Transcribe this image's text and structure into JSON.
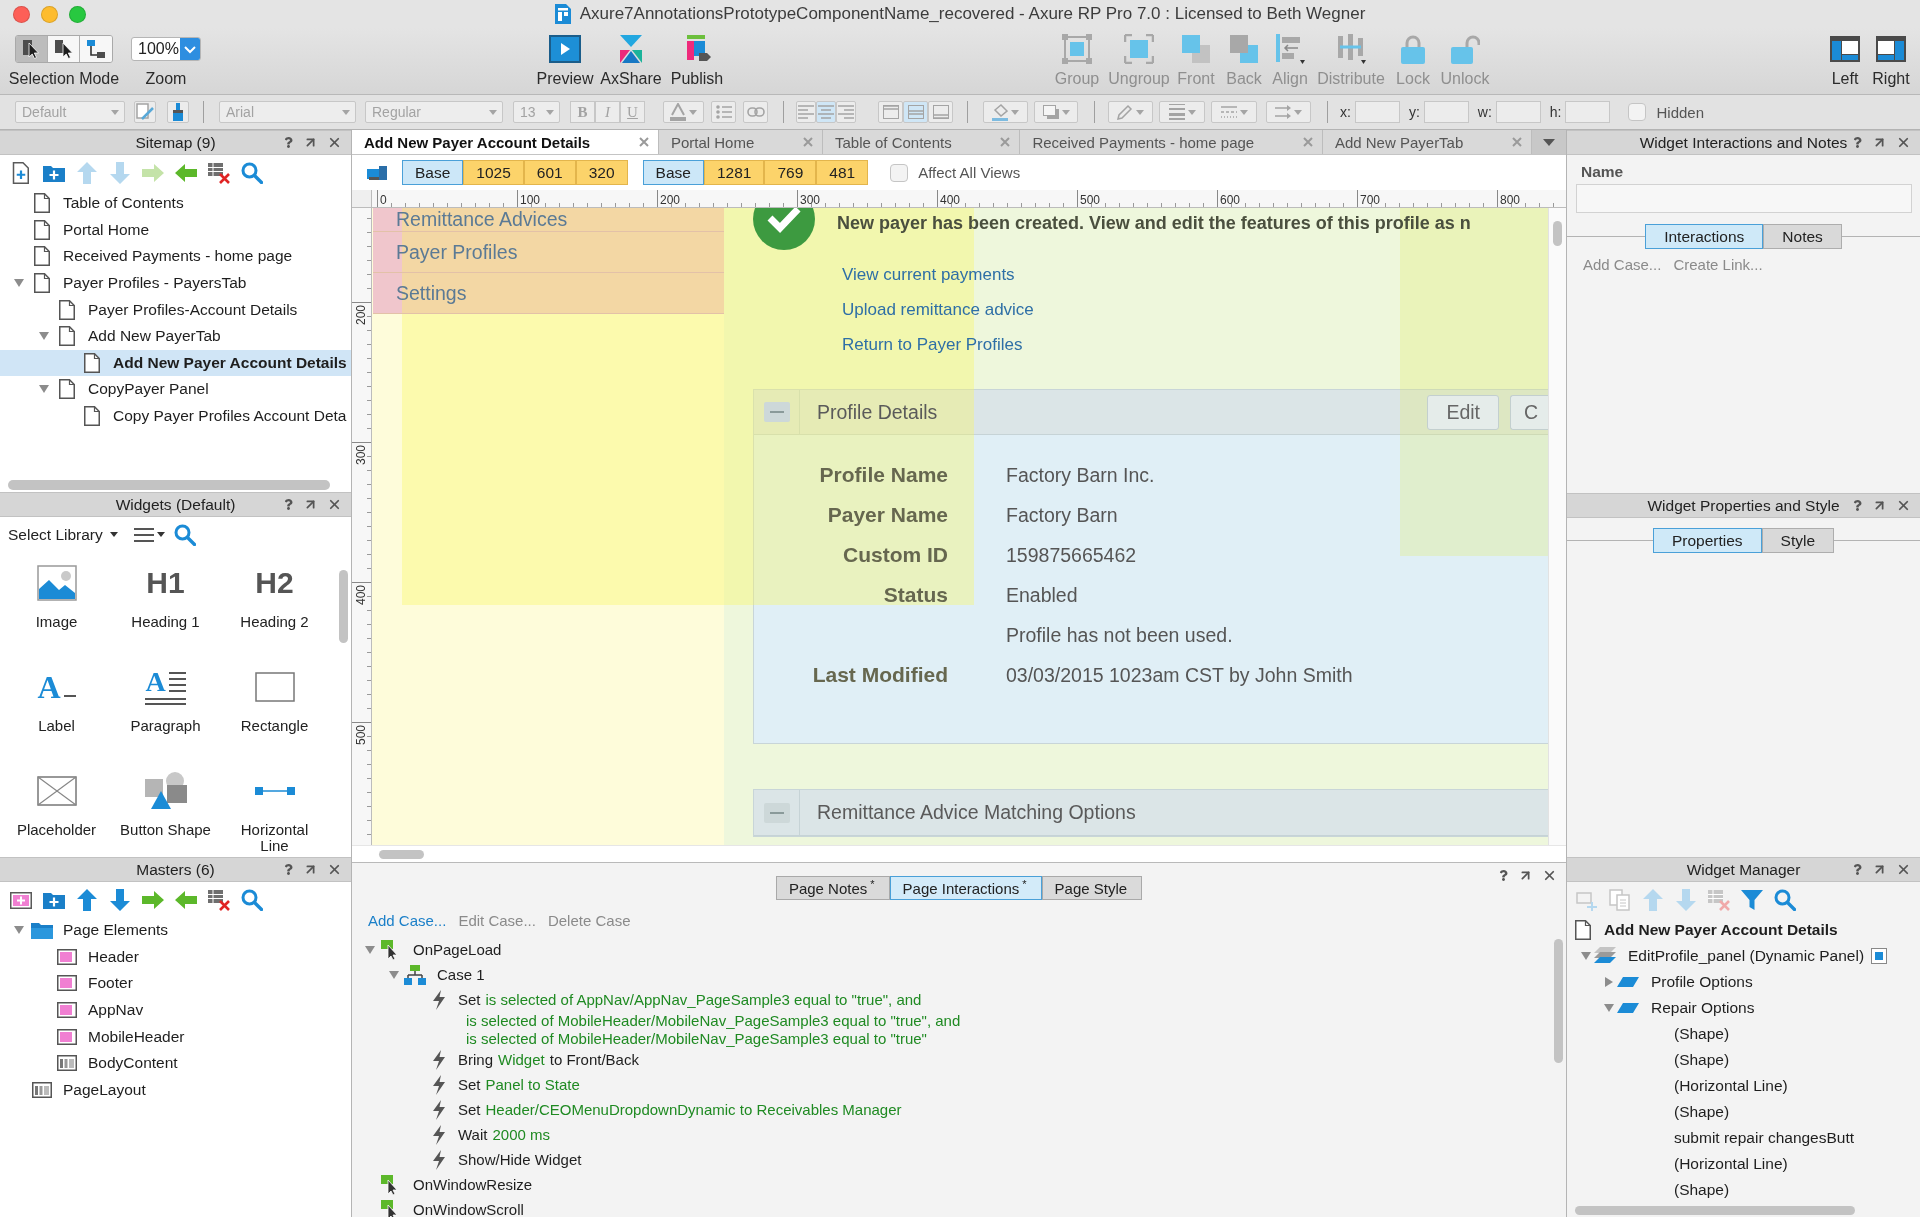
{
  "window": {
    "title": "Axure7AnnotationsPrototypeComponentName_recovered - Axure RP Pro 7.0 : Licensed to Beth Wegner"
  },
  "toolbar": {
    "selection_mode": {
      "label": "Selection Mode",
      "modes": [
        {
          "kind": "intersect",
          "selected": true
        },
        {
          "kind": "contain",
          "selected": false
        },
        {
          "kind": "connector",
          "selected": false
        }
      ]
    },
    "zoom": {
      "label": "Zoom",
      "value": "100%"
    },
    "publish_tools": [
      {
        "kind": "preview",
        "label": "Preview"
      },
      {
        "kind": "axshare",
        "label": "AxShare"
      },
      {
        "kind": "publish",
        "label": "Publish"
      }
    ],
    "arrange_tools": [
      {
        "kind": "group",
        "label": "Group",
        "disabled": true
      },
      {
        "kind": "ungroup",
        "label": "Ungroup",
        "disabled": true
      },
      {
        "kind": "front",
        "label": "Front",
        "disabled": true
      },
      {
        "kind": "back",
        "label": "Back",
        "disabled": true
      },
      {
        "kind": "align",
        "label": "Align",
        "disabled": true
      },
      {
        "kind": "distribute",
        "label": "Distribute",
        "disabled": true
      },
      {
        "kind": "lock",
        "label": "Lock",
        "disabled": true
      },
      {
        "kind": "unlock",
        "label": "Unlock",
        "disabled": true
      }
    ],
    "layout_tools": [
      {
        "kind": "left",
        "label": "Left"
      },
      {
        "kind": "right",
        "label": "Right"
      }
    ]
  },
  "format_bar": {
    "disabled": true,
    "style": "Default",
    "font_family": "Arial",
    "font_style": "Regular",
    "font_size": "13",
    "text_styles": [
      "B",
      "I",
      "U"
    ],
    "text_align": [
      {
        "kind": "left",
        "selected": false
      },
      {
        "kind": "center",
        "selected": true
      },
      {
        "kind": "right",
        "selected": false
      }
    ],
    "vertical_align": [
      {
        "kind": "top",
        "selected": false
      },
      {
        "kind": "middle",
        "selected": true
      },
      {
        "kind": "bottom",
        "selected": false
      }
    ],
    "position_fields": [
      "x:",
      "y:",
      "w:",
      "h:"
    ],
    "hidden": {
      "label": "Hidden",
      "checked": false
    }
  },
  "sitemap": {
    "title": "Sitemap (9)",
    "tools": [
      {
        "kind": "add_page",
        "disabled": false
      },
      {
        "kind": "add_folder",
        "disabled": false
      },
      {
        "kind": "move_up",
        "disabled": true
      },
      {
        "kind": "move_down",
        "disabled": true
      },
      {
        "kind": "indent",
        "disabled": true
      },
      {
        "kind": "outdent",
        "disabled": false
      },
      {
        "kind": "delete",
        "disabled": false
      },
      {
        "kind": "search",
        "disabled": false
      }
    ],
    "pages": [
      {
        "label": "Table of Contents",
        "selected": false
      },
      {
        "label": "Portal Home",
        "selected": false
      },
      {
        "label": "Received Payments - home page",
        "selected": false
      },
      {
        "label": "Payer Profiles - PayersTab",
        "selected": false,
        "expanded": true,
        "children": [
          {
            "label": "Payer Profiles-Account Details",
            "selected": false
          },
          {
            "label": "Add New PayerTab",
            "selected": false,
            "expanded": true,
            "children": [
              {
                "label": "Add New Payer Account Details",
                "selected": true
              }
            ]
          },
          {
            "label": "CopyPayer Panel",
            "selected": false,
            "expanded": true,
            "children": [
              {
                "label": "Copy Payer Profiles Account Deta",
                "selected": false
              }
            ]
          }
        ]
      }
    ]
  },
  "widgets": {
    "title": "Widgets (Default)",
    "library": "Select Library",
    "items": [
      {
        "kind": "image",
        "label": "Image"
      },
      {
        "kind": "heading",
        "glyph": "H1",
        "label": "Heading 1"
      },
      {
        "kind": "heading",
        "glyph": "H2",
        "label": "Heading 2"
      },
      {
        "kind": "label",
        "glyph": "A",
        "label": "Label"
      },
      {
        "kind": "paragraph",
        "glyph": "A",
        "label": "Paragraph"
      },
      {
        "kind": "rectangle",
        "label": "Rectangle"
      },
      {
        "kind": "placeholder",
        "label": "Placeholder"
      },
      {
        "kind": "button_shape",
        "label": "Button Shape"
      },
      {
        "kind": "horizontal_line",
        "label": "Horizontal Line"
      }
    ]
  },
  "masters": {
    "title": "Masters (6)",
    "tools": [
      {
        "kind": "add_master",
        "disabled": false
      },
      {
        "kind": "add_folder",
        "disabled": false
      },
      {
        "kind": "move_up",
        "disabled": false
      },
      {
        "kind": "move_down",
        "disabled": false
      },
      {
        "kind": "indent",
        "disabled": false
      },
      {
        "kind": "outdent",
        "disabled": false
      },
      {
        "kind": "delete",
        "disabled": false
      },
      {
        "kind": "search",
        "disabled": false
      }
    ],
    "items": [
      {
        "kind": "folder",
        "label": "Page Elements",
        "selected": false,
        "expanded": true,
        "children": [
          {
            "kind": "master",
            "label": "Header",
            "selected": false
          },
          {
            "kind": "master",
            "label": "Footer",
            "selected": false
          },
          {
            "kind": "master",
            "label": "AppNav",
            "selected": false
          },
          {
            "kind": "master",
            "label": "MobileHeader",
            "selected": false
          },
          {
            "kind": "layout",
            "label": "BodyContent",
            "selected": false
          }
        ]
      },
      {
        "kind": "layout",
        "label": "PageLayout",
        "selected": false
      }
    ]
  },
  "editor": {
    "tabs": [
      {
        "label": "Add New Payer Account Details",
        "selected": true
      },
      {
        "label": "Portal Home",
        "selected": false
      },
      {
        "label": "Table of Contents",
        "selected": false
      },
      {
        "label": "Received Payments - home page",
        "selected": false
      },
      {
        "label": "Add New PayerTab",
        "selected": false
      }
    ],
    "view_sets": [
      [
        {
          "label": "Base",
          "selected": true
        },
        {
          "label": "1025",
          "selected": false
        },
        {
          "label": "601",
          "selected": false
        },
        {
          "label": "320",
          "selected": false
        }
      ],
      [
        {
          "label": "Base",
          "selected": true
        },
        {
          "label": "1281",
          "selected": false
        },
        {
          "label": "769",
          "selected": false
        },
        {
          "label": "481",
          "selected": false
        }
      ]
    ],
    "affect_all_views": {
      "label": "Affect All Views",
      "checked": false
    },
    "ruler": {
      "horizontal": [
        "0",
        "100",
        "200",
        "300",
        "400",
        "500",
        "600",
        "700",
        "800"
      ],
      "vertical": [
        "200",
        "300",
        "400",
        "500"
      ]
    },
    "canvas": {
      "nav": [
        "Remittance Advices",
        "Payer Profiles",
        "Settings"
      ],
      "message": "New payer has been created. View and edit the features of this profile as n",
      "links": [
        "View current payments",
        "Upload remittance advice",
        "Return to Payer Profiles"
      ],
      "panels": [
        {
          "title": "Profile Details",
          "expanded": true,
          "actions": [
            "Edit",
            "C"
          ],
          "fields": [
            {
              "label": "Profile Name",
              "value": "Factory Barn Inc."
            },
            {
              "label": "Payer Name",
              "value": "Factory Barn"
            },
            {
              "label": "Custom ID",
              "value": "159875665462"
            },
            {
              "label": "Status",
              "value": "Enabled"
            },
            {
              "value": "Profile has not been used."
            },
            {
              "label": "Last Modified",
              "value": "03/03/2015 1023am CST by John Smith"
            }
          ]
        },
        {
          "title": "Remittance Advice Matching Options",
          "expanded": true
        }
      ]
    }
  },
  "page_panel": {
    "tabs": [
      {
        "label": "Page Notes",
        "badge": "*",
        "selected": false
      },
      {
        "label": "Page Interactions",
        "badge": "*",
        "selected": true
      },
      {
        "label": "Page Style",
        "selected": false
      }
    ],
    "actions": [
      {
        "label": "Add Case...",
        "disabled": false
      },
      {
        "label": "Edit Case...",
        "disabled": true
      },
      {
        "label": "Delete Case",
        "disabled": true
      }
    ],
    "events": [
      {
        "kind": "event",
        "label": "OnPageLoad",
        "expanded": true,
        "children": [
          {
            "kind": "case",
            "label": "Case 1",
            "expanded": true,
            "children": [
              {
                "kind": "action",
                "parts": [
                  {
                    "kind": "plain",
                    "text": "Set"
                  },
                  {
                    "kind": "value",
                    "text": "is selected of AppNav/AppNav_PageSample3 equal to \"true\", and"
                  }
                ],
                "continued": [
                  "is selected of MobileHeader/MobileNav_PageSample3 equal to \"true\", and",
                  "is selected of MobileHeader/MobileNav_PageSample3 equal to \"true\""
                ]
              },
              {
                "kind": "action",
                "parts": [
                  {
                    "kind": "plain",
                    "text": "Bring"
                  },
                  {
                    "kind": "value",
                    "text": "Widget"
                  },
                  {
                    "kind": "plain",
                    "text": "to Front/Back"
                  }
                ]
              },
              {
                "kind": "action",
                "parts": [
                  {
                    "kind": "plain",
                    "text": "Set"
                  },
                  {
                    "kind": "value",
                    "text": "Panel to State"
                  }
                ]
              },
              {
                "kind": "action",
                "parts": [
                  {
                    "kind": "plain",
                    "text": "Set"
                  },
                  {
                    "kind": "value",
                    "text": "Header/CEOMenuDropdownDynamic to Receivables Manager"
                  }
                ]
              },
              {
                "kind": "action",
                "parts": [
                  {
                    "kind": "plain",
                    "text": "Wait"
                  },
                  {
                    "kind": "value",
                    "text": "2000 ms"
                  }
                ]
              },
              {
                "kind": "action",
                "parts": [
                  {
                    "kind": "plain",
                    "text": "Show/Hide Widget"
                  }
                ]
              }
            ]
          }
        ]
      },
      {
        "kind": "event",
        "label": "OnWindowResize"
      },
      {
        "kind": "event",
        "label": "OnWindowScroll"
      }
    ]
  },
  "widget_interactions": {
    "title": "Widget Interactions and Notes",
    "name_label": "Name",
    "tabs": [
      {
        "label": "Interactions",
        "selected": true
      },
      {
        "label": "Notes",
        "selected": false
      }
    ],
    "actions": [
      {
        "label": "Add Case...",
        "disabled": true
      },
      {
        "label": "Create Link...",
        "disabled": true
      }
    ]
  },
  "widget_properties": {
    "title": "Widget Properties and Style",
    "tabs": [
      {
        "label": "Properties",
        "selected": true
      },
      {
        "label": "Style",
        "selected": false
      }
    ]
  },
  "widget_manager": {
    "title": "Widget Manager",
    "tools": [
      {
        "kind": "add_state",
        "disabled": true
      },
      {
        "kind": "duplicate",
        "disabled": true
      },
      {
        "kind": "move_up",
        "disabled": true
      },
      {
        "kind": "move_down",
        "disabled": true
      },
      {
        "kind": "delete",
        "disabled": true
      },
      {
        "kind": "filter",
        "disabled": false
      },
      {
        "kind": "search",
        "disabled": false
      }
    ],
    "page": "Add New Payer Account Details",
    "items": [
      {
        "kind": "dynamic_panel",
        "label": "EditProfile_panel (Dynamic Panel)",
        "selected": false,
        "expanded": true,
        "children": [
          {
            "kind": "state",
            "label": "Profile Options",
            "selected": false,
            "expanded": false
          },
          {
            "kind": "state",
            "label": "Repair Options",
            "selected": false,
            "expanded": true,
            "children": [
              {
                "kind": "widget",
                "label": "(Shape)",
                "selected": false
              },
              {
                "kind": "widget",
                "label": "(Shape)",
                "selected": false
              },
              {
                "kind": "widget",
                "label": "(Horizontal Line)",
                "selected": false
              },
              {
                "kind": "widget",
                "label": "(Shape)",
                "selected": false
              },
              {
                "kind": "widget",
                "label": "submit repair changesButt",
                "selected": false
              },
              {
                "kind": "widget",
                "label": "(Horizontal Line)",
                "selected": false
              },
              {
                "kind": "widget",
                "label": "(Shape)",
                "selected": false
              }
            ]
          }
        ]
      }
    ]
  }
}
